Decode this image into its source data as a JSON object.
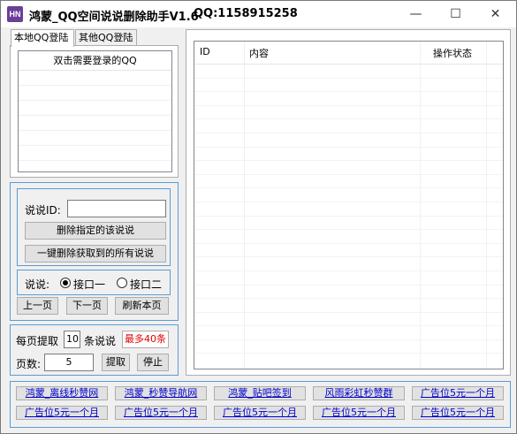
{
  "window": {
    "app_icon_text": "HN",
    "title": "鸿蒙_QQ空间说说删除助手V1.6",
    "qq_label": "QQ:1158915258",
    "minimize": "—",
    "maximize": "☐",
    "close": "✕"
  },
  "tabs": [
    {
      "label": "本地QQ登陆"
    },
    {
      "label": "其他QQ登陆"
    }
  ],
  "qq_list": {
    "header": "双击需要登录的QQ"
  },
  "delete_group": {
    "id_label": "说说ID:",
    "id_value": "",
    "delete_one_button": "删除指定的该说说",
    "delete_all_button": "一键删除获取到的所有说说"
  },
  "interface_group": {
    "label": "说说:",
    "options": [
      {
        "label": "接口一",
        "checked": true
      },
      {
        "label": "接口二",
        "checked": false
      }
    ]
  },
  "paging": {
    "prev": "上一页",
    "next": "下一页",
    "refresh": "刷新本页"
  },
  "fetch_group": {
    "per_page_label": "每页提取",
    "per_page_value": "10",
    "unit_label": "条说说",
    "max_label": "最多40条",
    "page_label": "页数:",
    "page_value": "5",
    "fetch_button": "提取",
    "stop_button": "停止"
  },
  "table": {
    "columns": [
      "ID",
      "内容",
      "操作状态"
    ],
    "rows": []
  },
  "ads": {
    "row1": [
      "鸿蒙_离线秒赞网",
      "鸿蒙_秒赞导航网",
      "鸿蒙_贴吧签到",
      "风雨彩虹秒赞群",
      "广告位5元一个月"
    ],
    "row2": [
      "广告位5元一个月",
      "广告位5元一个月",
      "广告位5元一个月",
      "广告位5元一个月",
      "广告位5元一个月"
    ]
  },
  "colors": {
    "group_border": "#5b9bd5",
    "warn_text": "#e00000",
    "link_text": "#0000cc"
  }
}
